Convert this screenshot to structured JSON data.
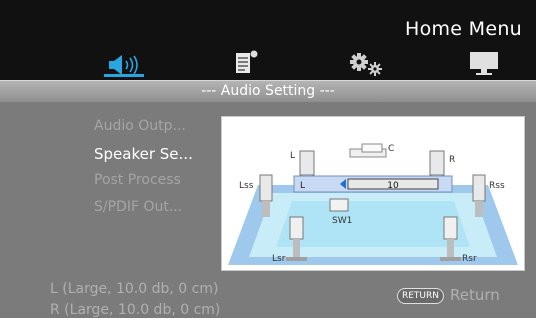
{
  "header": {
    "title": "Home Menu",
    "tabs": [
      {
        "icon": "speaker-icon",
        "active": true
      },
      {
        "icon": "document-icon",
        "active": false
      },
      {
        "icon": "settings-gears-icon",
        "active": false
      },
      {
        "icon": "monitor-icon",
        "active": false
      }
    ]
  },
  "subtitle": "--- Audio Setting ---",
  "menu": {
    "items": [
      {
        "label": "Audio Outp...",
        "selected": false
      },
      {
        "label": "Speaker Se...",
        "selected": true
      },
      {
        "label": "Post Process",
        "selected": false
      },
      {
        "label": "S/PDIF Out...",
        "selected": false
      }
    ]
  },
  "diagram": {
    "speakers": {
      "front_left": "L",
      "center": "C",
      "front_right": "R",
      "side_left": "Lss",
      "side_right": "Rss",
      "subwoofer": "SW1",
      "rear_left": "Lsr",
      "rear_right": "Rsr"
    },
    "selection": {
      "channel": "L",
      "value": "10"
    }
  },
  "status_lines": [
    "L (Large, 10.0 db, 0 cm)",
    "R (Large, 10.0 db, 0 cm)"
  ],
  "footer": {
    "return_badge": "RETURN",
    "return_label": "Return"
  },
  "colors": {
    "accent": "#29a6e0",
    "header_bg": "#111111",
    "room_floor": "#aee4f5",
    "room_edge": "#9fc9ec"
  }
}
